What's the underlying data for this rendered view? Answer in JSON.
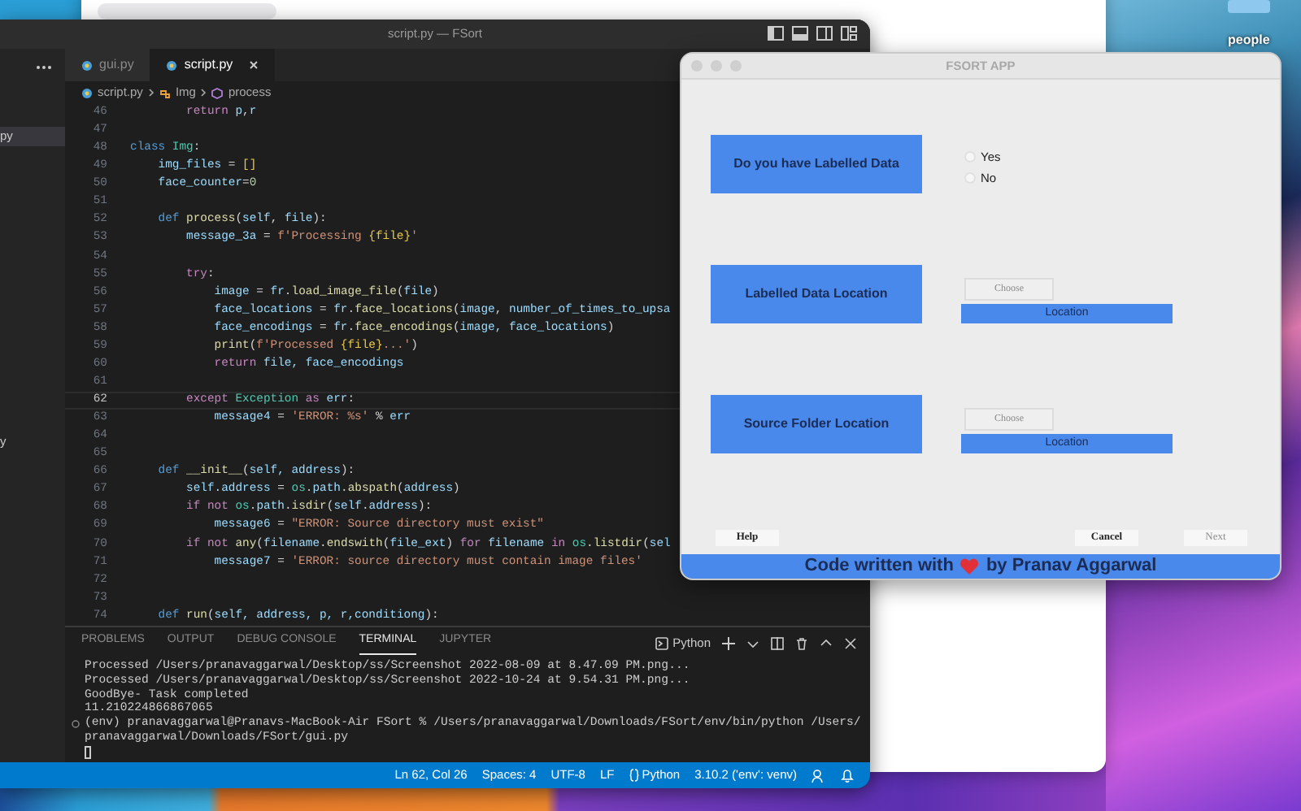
{
  "desktop": {
    "folder_label": "people"
  },
  "editor_window": {
    "title": "script.py — FSort",
    "explorer_items": [
      {
        "label": "py",
        "selected": true
      },
      {
        "label": "y",
        "selected": false
      }
    ],
    "tabs": [
      {
        "label": "gui.py",
        "selected": false
      },
      {
        "label": "script.py",
        "selected": true
      }
    ],
    "breadcrumb": [
      {
        "kind": "file",
        "label": "script.py"
      },
      {
        "kind": "class",
        "label": "Img"
      },
      {
        "kind": "method",
        "label": "process"
      }
    ],
    "code_lines": [
      {
        "number": "46",
        "current": false,
        "tokens": [
          {
            "kind": "ctrl",
            "text": "        return"
          },
          {
            "kind": "var",
            "text": " p"
          },
          {
            "kind": "plain",
            "text": ","
          },
          {
            "kind": "var",
            "text": "r"
          }
        ]
      },
      {
        "number": "47",
        "current": false
      },
      {
        "number": "48",
        "current": false,
        "tokens": [
          {
            "kind": "kw",
            "text": "class"
          },
          {
            "kind": "cls",
            "text": " Img"
          },
          {
            "kind": "plain",
            "text": ":"
          }
        ]
      },
      {
        "number": "49",
        "current": false,
        "tokens": [
          {
            "kind": "var",
            "text": "    img_files"
          },
          {
            "kind": "plain",
            "text": " = "
          },
          {
            "kind": "brace",
            "text": "[]"
          }
        ]
      },
      {
        "number": "50",
        "current": false,
        "tokens": [
          {
            "kind": "var",
            "text": "    face_counter"
          },
          {
            "kind": "plain",
            "text": "="
          },
          {
            "kind": "num",
            "text": "0"
          }
        ]
      },
      {
        "number": "51",
        "current": false
      },
      {
        "number": "52",
        "current": false,
        "tokens": [
          {
            "kind": "kw",
            "text": "    def"
          },
          {
            "kind": "fn",
            "text": " process"
          },
          {
            "kind": "plain",
            "text": "("
          },
          {
            "kind": "var",
            "text": "self"
          },
          {
            "kind": "plain",
            "text": ", "
          },
          {
            "kind": "var",
            "text": "file"
          },
          {
            "kind": "plain",
            "text": "):"
          }
        ]
      },
      {
        "number": "53",
        "current": false,
        "tokens": [
          {
            "kind": "var",
            "text": "        message_3a"
          },
          {
            "kind": "plain",
            "text": " = "
          },
          {
            "kind": "str",
            "text": "f'Processing "
          },
          {
            "kind": "brace",
            "text": "{file}"
          },
          {
            "kind": "str",
            "text": "'"
          }
        ]
      },
      {
        "number": "54",
        "current": false
      },
      {
        "number": "55",
        "current": false,
        "tokens": [
          {
            "kind": "ctrl",
            "text": "        try"
          },
          {
            "kind": "plain",
            "text": ":"
          }
        ]
      },
      {
        "number": "56",
        "current": false,
        "tokens": [
          {
            "kind": "var",
            "text": "            image"
          },
          {
            "kind": "plain",
            "text": " = "
          },
          {
            "kind": "var",
            "text": "fr"
          },
          {
            "kind": "plain",
            "text": "."
          },
          {
            "kind": "fn",
            "text": "load_image_file"
          },
          {
            "kind": "plain",
            "text": "("
          },
          {
            "kind": "var",
            "text": "file"
          },
          {
            "kind": "plain",
            "text": ")"
          }
        ]
      },
      {
        "number": "57",
        "current": false,
        "tokens": [
          {
            "kind": "var",
            "text": "            face_locations"
          },
          {
            "kind": "plain",
            "text": " = "
          },
          {
            "kind": "var",
            "text": "fr"
          },
          {
            "kind": "plain",
            "text": "."
          },
          {
            "kind": "fn",
            "text": "face_locations"
          },
          {
            "kind": "plain",
            "text": "("
          },
          {
            "kind": "var",
            "text": "image"
          },
          {
            "kind": "plain",
            "text": ", "
          },
          {
            "kind": "var",
            "text": "number_of_times_to_upsa"
          }
        ]
      },
      {
        "number": "58",
        "current": false,
        "tokens": [
          {
            "kind": "var",
            "text": "            face_encodings"
          },
          {
            "kind": "plain",
            "text": " = "
          },
          {
            "kind": "var",
            "text": "fr"
          },
          {
            "kind": "plain",
            "text": "."
          },
          {
            "kind": "fn",
            "text": "face_encodings"
          },
          {
            "kind": "plain",
            "text": "("
          },
          {
            "kind": "var",
            "text": "image, face_locations"
          },
          {
            "kind": "plain",
            "text": ")"
          }
        ]
      },
      {
        "number": "59",
        "current": false,
        "tokens": [
          {
            "kind": "fn",
            "text": "            print"
          },
          {
            "kind": "plain",
            "text": "("
          },
          {
            "kind": "str",
            "text": "f'Processed "
          },
          {
            "kind": "brace",
            "text": "{file}"
          },
          {
            "kind": "str",
            "text": "...'"
          },
          {
            "kind": "plain",
            "text": ")"
          }
        ]
      },
      {
        "number": "60",
        "current": false,
        "tokens": [
          {
            "kind": "ctrl",
            "text": "            return"
          },
          {
            "kind": "var",
            "text": " file, face_encodings"
          }
        ]
      },
      {
        "number": "61",
        "current": false
      },
      {
        "number": "62",
        "current": true,
        "tokens": [
          {
            "kind": "ctrl",
            "text": "        except"
          },
          {
            "kind": "cls",
            "text": " Exception"
          },
          {
            "kind": "ctrl",
            "text": " as"
          },
          {
            "kind": "var",
            "text": " err"
          },
          {
            "kind": "plain",
            "text": ":"
          }
        ]
      },
      {
        "number": "63",
        "current": false,
        "tokens": [
          {
            "kind": "var",
            "text": "            message4"
          },
          {
            "kind": "plain",
            "text": " = "
          },
          {
            "kind": "str",
            "text": "'ERROR: %s'"
          },
          {
            "kind": "plain",
            "text": " % "
          },
          {
            "kind": "var",
            "text": "err"
          }
        ]
      },
      {
        "number": "64",
        "current": false
      },
      {
        "number": "65",
        "current": false
      },
      {
        "number": "66",
        "current": false,
        "tokens": [
          {
            "kind": "kw",
            "text": "    def"
          },
          {
            "kind": "fn",
            "text": " __init__"
          },
          {
            "kind": "plain",
            "text": "("
          },
          {
            "kind": "var",
            "text": "self, address"
          },
          {
            "kind": "plain",
            "text": "):"
          }
        ]
      },
      {
        "number": "67",
        "current": false,
        "tokens": [
          {
            "kind": "var",
            "text": "        self"
          },
          {
            "kind": "plain",
            "text": "."
          },
          {
            "kind": "var",
            "text": "address"
          },
          {
            "kind": "plain",
            "text": " = "
          },
          {
            "kind": "cls",
            "text": "os"
          },
          {
            "kind": "plain",
            "text": "."
          },
          {
            "kind": "var",
            "text": "path"
          },
          {
            "kind": "plain",
            "text": "."
          },
          {
            "kind": "fn",
            "text": "abspath"
          },
          {
            "kind": "plain",
            "text": "("
          },
          {
            "kind": "var",
            "text": "address"
          },
          {
            "kind": "plain",
            "text": ")"
          }
        ]
      },
      {
        "number": "68",
        "current": false,
        "tokens": [
          {
            "kind": "ctrl",
            "text": "        if"
          },
          {
            "kind": "ctrl",
            "text": " not"
          },
          {
            "kind": "cls",
            "text": " os"
          },
          {
            "kind": "plain",
            "text": "."
          },
          {
            "kind": "var",
            "text": "path"
          },
          {
            "kind": "plain",
            "text": "."
          },
          {
            "kind": "fn",
            "text": "isdir"
          },
          {
            "kind": "plain",
            "text": "("
          },
          {
            "kind": "var",
            "text": "self"
          },
          {
            "kind": "plain",
            "text": "."
          },
          {
            "kind": "var",
            "text": "address"
          },
          {
            "kind": "plain",
            "text": "):"
          }
        ]
      },
      {
        "number": "69",
        "current": false,
        "tokens": [
          {
            "kind": "var",
            "text": "            message6"
          },
          {
            "kind": "plain",
            "text": " = "
          },
          {
            "kind": "str",
            "text": "\"ERROR: Source directory must exist\""
          }
        ]
      },
      {
        "number": "70",
        "current": false,
        "tokens": [
          {
            "kind": "ctrl",
            "text": "        if"
          },
          {
            "kind": "ctrl",
            "text": " not"
          },
          {
            "kind": "fn",
            "text": " any"
          },
          {
            "kind": "plain",
            "text": "("
          },
          {
            "kind": "var",
            "text": "filename"
          },
          {
            "kind": "plain",
            "text": "."
          },
          {
            "kind": "fn",
            "text": "endswith"
          },
          {
            "kind": "plain",
            "text": "("
          },
          {
            "kind": "var",
            "text": "file_ext"
          },
          {
            "kind": "plain",
            "text": ") "
          },
          {
            "kind": "ctrl",
            "text": "for"
          },
          {
            "kind": "var",
            "text": " filename"
          },
          {
            "kind": "ctrl",
            "text": " in"
          },
          {
            "kind": "cls",
            "text": " os"
          },
          {
            "kind": "plain",
            "text": "."
          },
          {
            "kind": "fn",
            "text": "listdir"
          },
          {
            "kind": "plain",
            "text": "("
          },
          {
            "kind": "var",
            "text": "sel"
          }
        ]
      },
      {
        "number": "71",
        "current": false,
        "tokens": [
          {
            "kind": "var",
            "text": "            message7"
          },
          {
            "kind": "plain",
            "text": " = "
          },
          {
            "kind": "str",
            "text": "'ERROR: source directory must contain image files'"
          }
        ]
      },
      {
        "number": "72",
        "current": false
      },
      {
        "number": "73",
        "current": false
      },
      {
        "number": "74",
        "current": false,
        "tokens": [
          {
            "kind": "kw",
            "text": "    def"
          },
          {
            "kind": "fn",
            "text": " run"
          },
          {
            "kind": "plain",
            "text": "("
          },
          {
            "kind": "var",
            "text": "self, address, p, r,conditiong"
          },
          {
            "kind": "plain",
            "text": "):"
          }
        ]
      }
    ],
    "panel": {
      "tabs": [
        {
          "label": "PROBLEMS",
          "selected": false
        },
        {
          "label": "OUTPUT",
          "selected": false
        },
        {
          "label": "DEBUG CONSOLE",
          "selected": false
        },
        {
          "label": "TERMINAL",
          "selected": true
        },
        {
          "label": "JUPYTER",
          "selected": false
        }
      ],
      "terminal_profile": "Python",
      "terminal_lines": [
        {
          "kind": "output",
          "text": "Processed /Users/pranavaggarwal/Desktop/ss/Screenshot 2022-08-09 at 8.47.09 PM.png..."
        },
        {
          "kind": "output",
          "text": "Processed /Users/pranavaggarwal/Desktop/ss/Screenshot 2022-10-24 at 9.54.31 PM.png..."
        },
        {
          "kind": "output",
          "text": "GoodBye- Task completed"
        },
        {
          "kind": "output",
          "text": "11.210224866867065"
        },
        {
          "kind": "command",
          "text": "(env) pranavaggarwal@Pranavs-MacBook-Air FSort % /Users/pranavaggarwal/Downloads/FSort/env/bin/python /Users/"
        },
        {
          "kind": "output",
          "text": "pranavaggarwal/Downloads/FSort/gui.py"
        },
        {
          "kind": "cursor"
        }
      ]
    },
    "status_bar": [
      {
        "kind": "text",
        "label": "Ln 62, Col 26"
      },
      {
        "kind": "text",
        "label": "Spaces: 4"
      },
      {
        "kind": "text",
        "label": "UTF-8"
      },
      {
        "kind": "text",
        "label": "LF"
      },
      {
        "kind": "language",
        "label": "Python"
      },
      {
        "kind": "text",
        "label": "3.10.2 ('env': venv)"
      },
      {
        "kind": "feedback"
      },
      {
        "kind": "bell"
      }
    ]
  },
  "app_window": {
    "title": "FSORT APP",
    "rows": [
      {
        "kind": "radio",
        "label": "Do you have Labelled Data",
        "options": [
          {
            "label": "Yes",
            "selected": false
          },
          {
            "label": "No",
            "selected": false
          }
        ]
      },
      {
        "kind": "location",
        "label": "Labelled Data Location",
        "button": {
          "label": "Choose",
          "disabled": true
        },
        "location": "Location"
      },
      {
        "kind": "location",
        "label": "Source Folder Location",
        "button": {
          "label": "Choose",
          "disabled": true
        },
        "location": "Location"
      }
    ],
    "buttons": [
      {
        "label": "Help",
        "disabled": false
      },
      {
        "label": "Cancel",
        "disabled": false
      },
      {
        "label": "Next",
        "disabled": true
      }
    ],
    "footer": {
      "before": "Code written with",
      "after": "by Pranav Aggarwal"
    }
  }
}
